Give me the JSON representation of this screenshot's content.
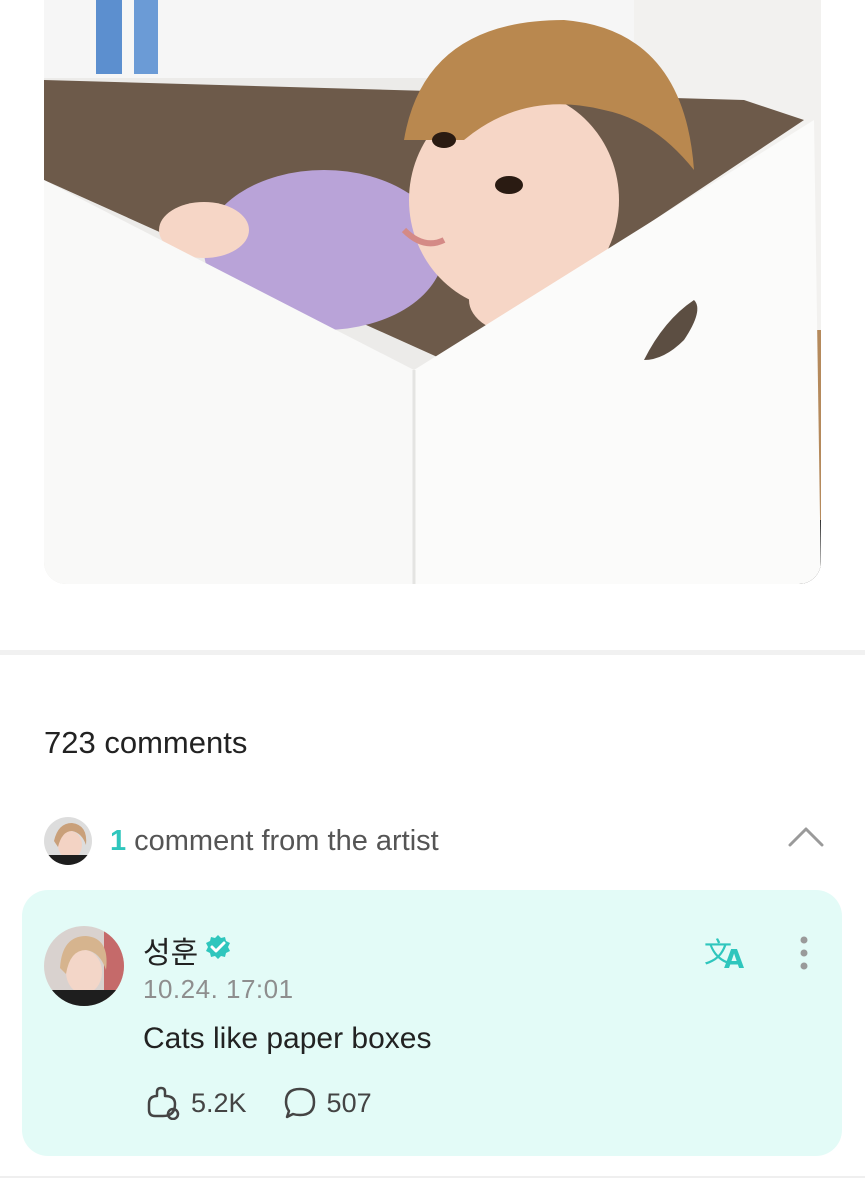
{
  "post": {
    "image_icon": "photo-of-person-in-cardboard-box"
  },
  "comments": {
    "count_label": "723 comments"
  },
  "artist_section": {
    "count": "1",
    "label": "comment from the artist",
    "toggle_icon": "chevron-up-icon"
  },
  "artist_comment": {
    "author": "성훈",
    "verified_icon": "verified-badge-icon",
    "timestamp": "10.24. 17:01",
    "text": "Cats like paper boxes",
    "translate_icon": "translate-icon",
    "more_icon": "more-vertical-icon",
    "likes": "5.2K",
    "replies": "507"
  },
  "colors": {
    "accent": "#2fc6bd",
    "card_bg": "#e3fbf7"
  }
}
